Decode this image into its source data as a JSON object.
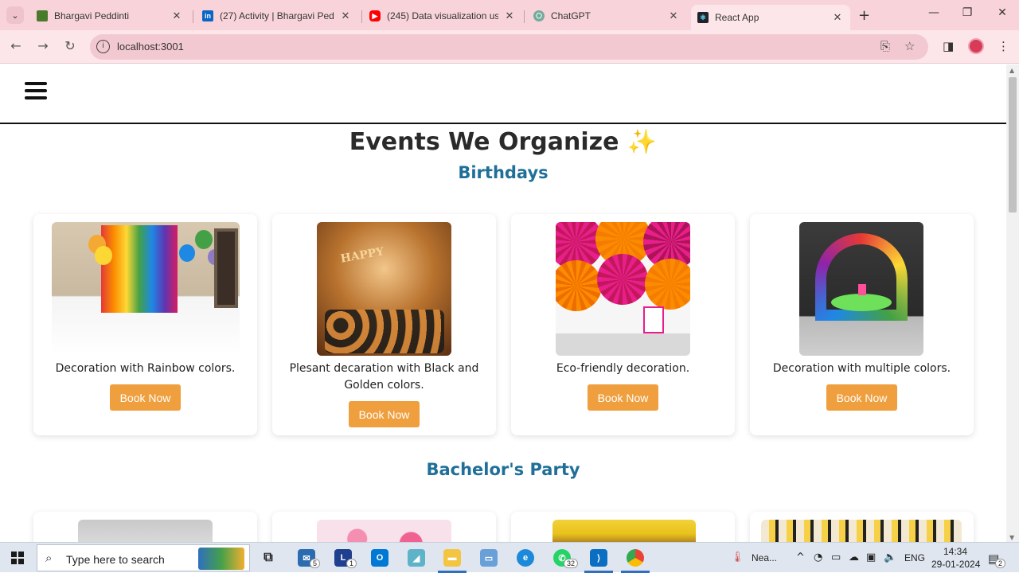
{
  "browser": {
    "tabs": [
      {
        "title": "Bhargavi Peddinti",
        "color": "#4a7a2c",
        "icon": "profile-favicon"
      },
      {
        "title": "(27) Activity | Bhargavi Peddi",
        "color": "#0a66c2",
        "icon": "linkedin-icon"
      },
      {
        "title": "(245) Data visualization usin",
        "color": "#ff0000",
        "icon": "youtube-icon"
      },
      {
        "title": "ChatGPT",
        "color": "#74aa9c",
        "icon": "chatgpt-icon"
      },
      {
        "title": "React App",
        "color": "#20232a",
        "icon": "react-icon"
      }
    ],
    "url": "localhost:3001"
  },
  "page": {
    "title": "Events We Organize",
    "title_emoji": "✨",
    "sections": [
      {
        "title": "Birthdays",
        "cards": [
          {
            "description": "Decoration with Rainbow colors.",
            "button": "Book Now"
          },
          {
            "description": "Plesant decaration with Black and Golden colors.",
            "button": "Book Now"
          },
          {
            "description": "Eco-friendly decoration.",
            "button": "Book Now"
          },
          {
            "description": "Decoration with multiple colors.",
            "button": "Book Now"
          }
        ]
      },
      {
        "title": "Bachelor's Party"
      }
    ]
  },
  "taskbar": {
    "search_placeholder": "Type here to search",
    "badges": {
      "mail": "5",
      "teams": "1",
      "whatsapp": "32"
    },
    "weather": "Nea...",
    "language": "ENG",
    "time": "14:34",
    "date": "29-01-2024",
    "notifications": "2"
  },
  "colors": {
    "accent_button": "#ef9f3e",
    "section_title": "#1f6f99",
    "tab_strip": "#f8d4da"
  }
}
